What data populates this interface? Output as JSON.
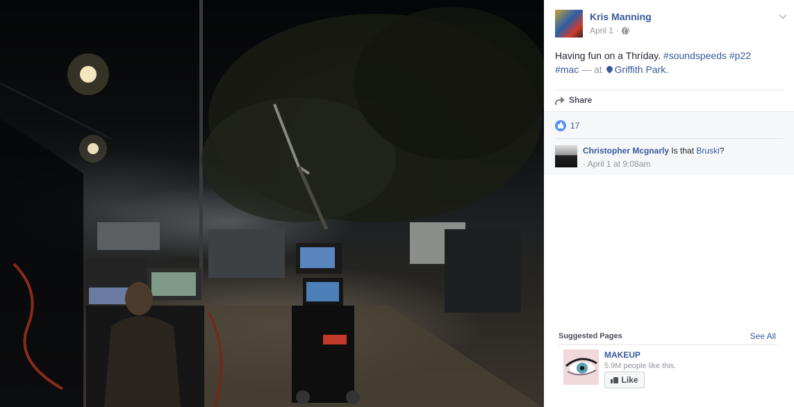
{
  "post": {
    "author": "Kris Manning",
    "date": "April 1",
    "date_sep": "·",
    "text_main": "Having fun on a Thríday.",
    "hashtags": [
      "#soundspeeds",
      "#p22",
      "#mac"
    ],
    "at_sep": "— at",
    "location": "Griffith Park",
    "location_end": ".",
    "share_label": "Share"
  },
  "feedback": {
    "like_count": "17",
    "comment": {
      "author": "Christopher Mcgnarly",
      "text": "Is that",
      "link": "Bruski",
      "text_end": "?",
      "time": "· April 1 at 9:08am"
    }
  },
  "suggested": {
    "title": "Suggested Pages",
    "see_all": "See All",
    "page": {
      "name": "MAKEUP",
      "likes_text": "5.9M people like this.",
      "like_button": "Like"
    }
  },
  "icons": {
    "privacy": "globe-icon",
    "options": "chevron-down-icon",
    "share": "share-arrow-icon",
    "reaction": "thumbs-up-icon",
    "location": "map-pin-icon"
  },
  "colors": {
    "link": "#365899",
    "muted": "#90949c",
    "like_bubble": "#5890ff"
  }
}
